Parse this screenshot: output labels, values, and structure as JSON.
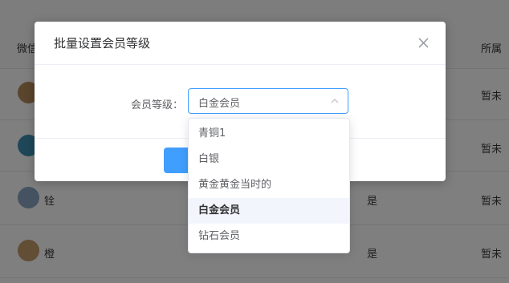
{
  "table": {
    "header": {
      "col1": "微信",
      "col_right": "所属",
      "col_right_suffix": ""
    },
    "rows": [
      {
        "name": "",
        "flag": "",
        "status": "暂未"
      },
      {
        "name": "",
        "flag": "",
        "status": "暂未"
      },
      {
        "name": "铨",
        "flag": "是",
        "status": "暂未"
      },
      {
        "name": "橙",
        "flag": "是",
        "status": "暂未"
      }
    ]
  },
  "dialog": {
    "title": "批量设置会员等级",
    "close_icon": "close-icon",
    "label": "会员等级：",
    "selected_value": "白金会员",
    "arrow_icon": "chevron-up-icon",
    "confirm_label": ""
  },
  "dropdown": {
    "options": [
      "青铜1",
      "白银",
      "黄金黄金当时的",
      "白金会员",
      "钻石会员"
    ],
    "selected_index": 3
  },
  "colors": {
    "primary": "#409eff",
    "selected_bg": "#f2f6fc",
    "overlay": "rgba(0,0,0,0.5)"
  }
}
